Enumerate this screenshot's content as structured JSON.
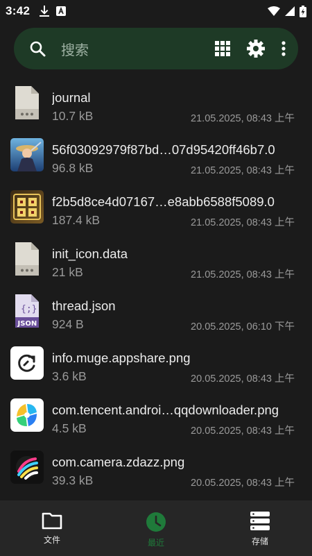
{
  "status": {
    "time": "3:42"
  },
  "search": {
    "placeholder": "搜索"
  },
  "colors": {
    "accent": "#1f7a3a",
    "search_bg": "#1e3a26",
    "background": "#1b1b1b",
    "nav_bg": "#262626"
  },
  "files": [
    {
      "name": "journal",
      "size": "10.7 kB",
      "date": "21.05.2025, 08:43 上午",
      "icon": "generic-file-icon"
    },
    {
      "name": "56f03092979f87bd…07d95420ff46b7.0",
      "size": "96.8 kB",
      "date": "21.05.2025, 08:43 上午",
      "icon": "game-image-thumbnail"
    },
    {
      "name": "f2b5d8ce4d07167…e8abb6588f5089.0",
      "size": "187.4 kB",
      "date": "21.05.2025, 08:43 上午",
      "icon": "game-logo-thumbnail"
    },
    {
      "name": "init_icon.data",
      "size": "21 kB",
      "date": "21.05.2025, 08:43 上午",
      "icon": "generic-file-icon"
    },
    {
      "name": "thread.json",
      "size": "924 B",
      "date": "20.05.2025, 06:10 下午",
      "icon": "json-file-icon"
    },
    {
      "name": "info.muge.appshare.png",
      "size": "3.6 kB",
      "date": "20.05.2025, 08:43 上午",
      "icon": "appshare-app-icon"
    },
    {
      "name": "com.tencent.androi…qqdownloader.png",
      "size": "4.5 kB",
      "date": "20.05.2025, 08:43 上午",
      "icon": "qqdownloader-app-icon"
    },
    {
      "name": "com.camera.zdazz.png",
      "size": "39.3 kB",
      "date": "20.05.2025, 08:43 上午",
      "icon": "camera-app-icon"
    }
  ],
  "nav": {
    "files_label": "文件",
    "recent_label": "最近",
    "storage_label": "存储"
  }
}
